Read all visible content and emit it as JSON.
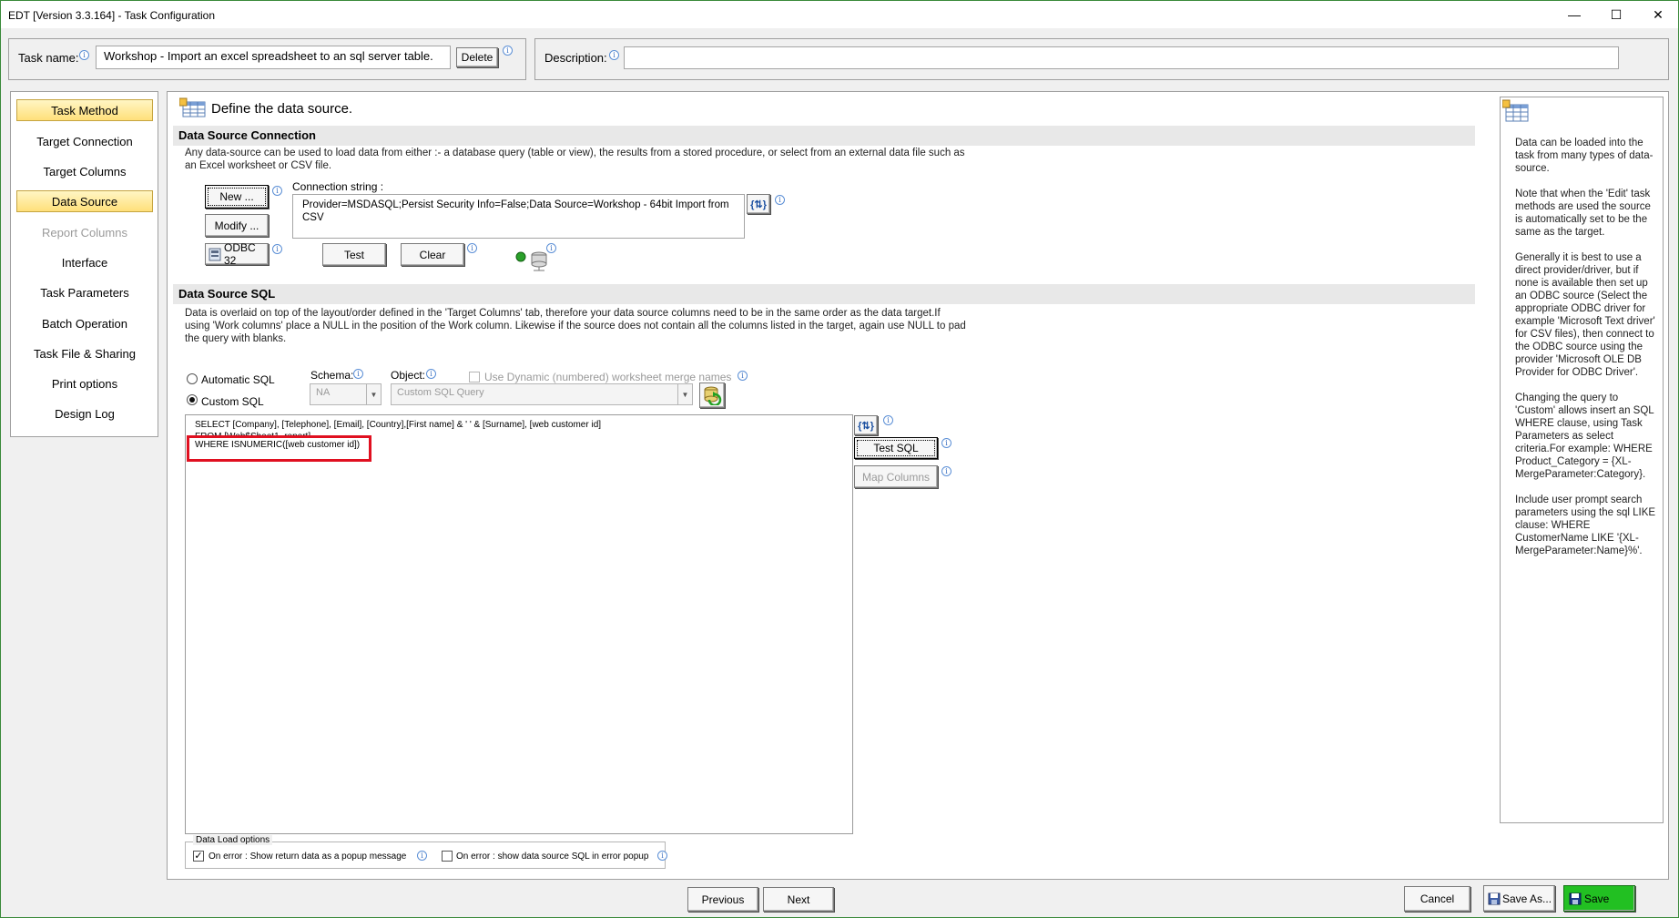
{
  "window": {
    "title": "EDT [Version 3.3.164] - Task Configuration",
    "minimize": "—",
    "maximize": "☐",
    "close": "✕"
  },
  "task": {
    "name_label": "Task name:",
    "name_value": "Workshop - Import an excel spreadsheet to an sql server table.",
    "delete_label": "Delete",
    "description_label": "Description:",
    "description_value": ""
  },
  "nav": {
    "items": [
      {
        "label": "Task Method"
      },
      {
        "label": "Target Connection"
      },
      {
        "label": "Target Columns"
      },
      {
        "label": "Data Source"
      },
      {
        "label": "Report Columns"
      },
      {
        "label": "Interface"
      },
      {
        "label": "Task Parameters"
      },
      {
        "label": "Batch Operation"
      },
      {
        "label": "Task File & Sharing"
      },
      {
        "label": "Print options"
      },
      {
        "label": "Design Log"
      }
    ]
  },
  "main": {
    "heading": "Define the data source.",
    "connection": {
      "header": "Data Source Connection",
      "description": "Any data-source can be used to load data from either :- a database query (table or view), the results from a stored procedure, or select from an external data file such as an Excel worksheet or CSV file.",
      "new_label": "New ...",
      "modify_label": "Modify ...",
      "odbc_label": "ODBC 32",
      "conn_string_label": "Connection string :",
      "conn_string_value": "Provider=MSDASQL;Persist Security Info=False;Data Source=Workshop - 64bit Import from CSV",
      "param_button": "{⇅}",
      "test_label": "Test",
      "clear_label": "Clear"
    },
    "sql": {
      "header": "Data Source SQL",
      "description": "Data is overlaid on top of the layout/order defined in the 'Target Columns' tab,  therefore your data source columns need to be in the same order as the data target.If using 'Work columns' place a NULL in the position of the Work column.  Likewise if the source does not contain all the columns listed in the target, again use NULL to pad the query with blanks.",
      "automatic_label": "Automatic SQL",
      "custom_label": "Custom SQL",
      "schema_label": "Schema:",
      "schema_value": "NA",
      "object_label": "Object:",
      "object_value": "Custom SQL Query",
      "dynamic_label": "Use Dynamic (numbered) worksheet merge names",
      "query_lines": [
        "SELECT [Company], [Telephone], [Email], [Country],[First name] & ' ' & [Surname], [web customer id]",
        "FROM [Web$Sheet1_report]",
        "WHERE ISNUMERIC([web customer id])"
      ],
      "test_sql_label": "Test SQL",
      "map_columns_label": "Map Columns",
      "highlight_color": "#e01020"
    },
    "load_options": {
      "legend": "Data Load options",
      "option1": "On error : Show return data as a popup message",
      "option2": "On error : show data source SQL in error popup"
    }
  },
  "help": {
    "text": "Data can be loaded into the task from many types of data-source.\n\nNote that when the 'Edit' task methods are used the source is automatically set to be the same as the target.\n\nGenerally it is best to use a direct provider/driver, but if none is available then set up an ODBC source (Select the appropriate ODBC driver for example 'Microsoft Text driver' for CSV files), then connect to the ODBC source using the provider 'Microsoft OLE DB Provider for ODBC Driver'.\n\nChanging the query to 'Custom' allows insert an SQL WHERE clause, using Task Parameters as select criteria.For example: WHERE Product_Category = {XL-MergeParameter:Category}.\n\nInclude user prompt search parameters using the sql LIKE clause: WHERE CustomerName LIKE '{XL-MergeParameter:Name}%'."
  },
  "footer": {
    "previous_label": "Previous",
    "next_label": "Next",
    "cancel_label": "Cancel",
    "save_as_label": "Save As...",
    "save_label": "Save",
    "save_color": "#22c022"
  },
  "info_glyph": "i"
}
